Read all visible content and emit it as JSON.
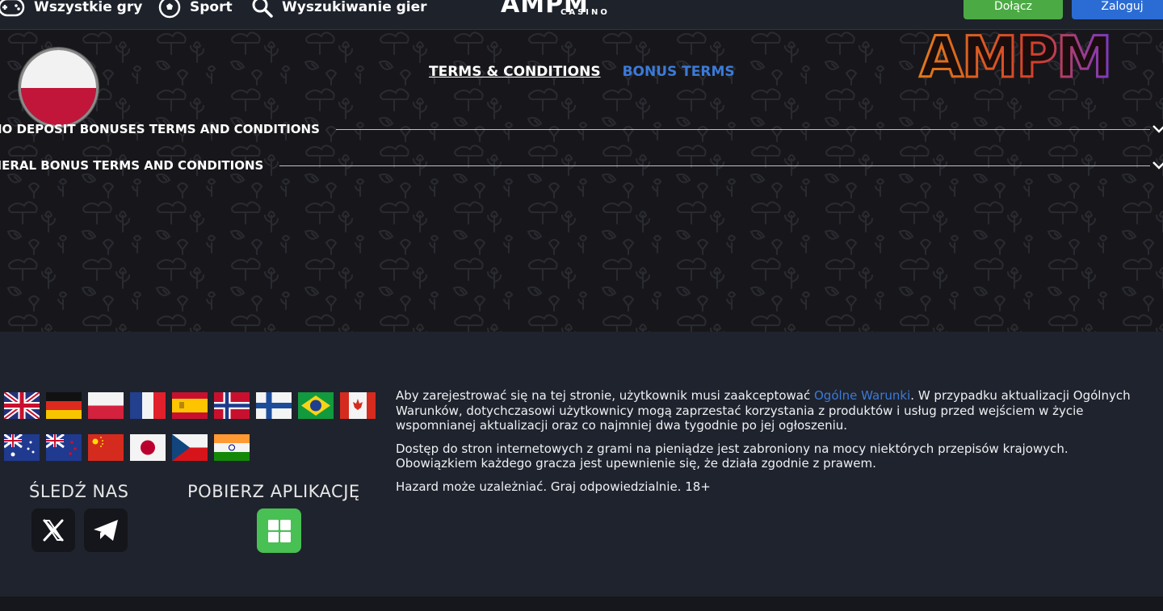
{
  "nav": {
    "all_games": "Wszystkie gry",
    "sport": "Sport",
    "game_search": "Wyszukiwanie gier",
    "brand_name": "AMPM",
    "brand_sub": "CASINO",
    "join": "Dołącz",
    "login": "Zaloguj"
  },
  "language": {
    "current_flag": "poland-flag-icon"
  },
  "tabs": {
    "terms": "TERMS & CONDITIONS",
    "bonus": "BONUS TERMS"
  },
  "promo": {
    "neon_logo": "AMPM"
  },
  "accordion": [
    {
      "title": "NO DEPOSIT BONUSES TERMS AND CONDITIONS"
    },
    {
      "title": "GENERAL BONUS TERMS AND CONDITIONS"
    }
  ],
  "footer": {
    "flags": [
      "uk",
      "germany",
      "poland",
      "france",
      "spain",
      "norway",
      "finland",
      "brazil",
      "canada",
      "australia",
      "new-zealand",
      "china",
      "japan",
      "czechia",
      "india"
    ],
    "follow_title": "ŚLEDŹ NAS",
    "app_title": "POBIERZ APLIKACJĘ",
    "social": [
      "x-icon",
      "telegram-icon"
    ],
    "app_icon": "windows-icon",
    "legal_p1_before": "Aby zarejestrować się na tej stronie, użytkownik musi zaakceptować ",
    "legal_p1_link": "Ogólne Warunki",
    "legal_p1_after": ". W przypadku aktualizacji Ogólnych Warunków, dotychczasowi użytkownicy mogą zaprzestać korzystania z produktów i usług przed wejściem w życie wspomnianej aktualizacji oraz co najmniej dwa tygodnie po jej ogłoszeniu.",
    "legal_p2": "Dostęp do stron internetowych z grami na pieniądze jest zabroniony na mocy niektórych przepisów krajowych. Obowiązkiem każdego gracza jest upewnienie się, że działa zgodnie z prawem.",
    "legal_p3": "Hazard może uzależniać. Graj odpowiedzialnie. 18+"
  },
  "colors": {
    "accent_blue": "#3b7ad9",
    "join_green": "#4caa45",
    "login_blue": "#2b6cd4",
    "app_green": "#48c053"
  }
}
